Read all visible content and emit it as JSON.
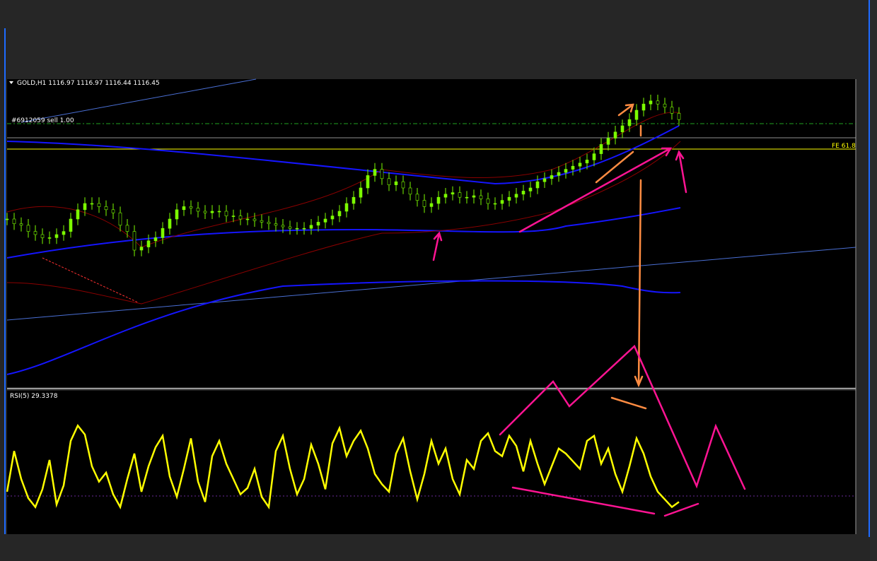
{
  "colors": {
    "background": "#000000",
    "frame": "#262626",
    "bull_candle": "#7CFC00",
    "ma": "#1515ff",
    "bands": "#8b0000",
    "trendline": "#4a6fd4",
    "order_line": "#1fa31f",
    "price_line": "#c0c0c0",
    "fe_line": "#ffff00",
    "rsi": "#ffff00",
    "annotation_pink": "#ff1493",
    "annotation_orange": "#ff8c42"
  },
  "header": {
    "symbol_label": "GOLD,H1  1116.97 1116.97 1116.44 1116.45"
  },
  "order": {
    "label": "#6912059 sell 1.00"
  },
  "fib": {
    "label": "FE 61.8"
  },
  "rsi_panel": {
    "label": "RSI(5) 29.3378"
  },
  "chart_data": {
    "type": "line",
    "symbol": "GOLD",
    "timeframe": "H1",
    "price_panel": {
      "x": [
        0,
        10,
        20,
        30,
        40,
        50,
        60,
        70,
        80,
        90,
        100,
        110,
        120,
        130,
        140,
        150,
        160,
        170,
        180,
        190,
        200,
        210,
        220,
        230,
        240,
        250,
        260,
        270,
        280,
        290,
        300,
        310,
        320,
        330,
        340,
        350,
        360,
        370,
        380,
        390,
        400,
        410,
        420,
        430,
        440,
        450,
        460,
        470,
        480,
        490,
        500,
        510,
        520,
        530,
        540,
        550,
        560,
        570,
        580,
        590,
        600,
        610,
        620,
        630,
        640,
        650,
        660,
        670,
        680,
        690,
        700,
        710,
        720,
        730,
        740,
        750,
        760,
        770,
        780,
        790,
        800,
        810,
        820,
        830,
        840,
        850,
        860,
        870,
        880,
        890,
        900,
        910,
        920,
        930,
        940,
        950
      ],
      "close": [
        50,
        47,
        46,
        42,
        40,
        38,
        38,
        40,
        42,
        50,
        56,
        60,
        60,
        58,
        56,
        54,
        46,
        42,
        30,
        32,
        36,
        38,
        44,
        50,
        56,
        58,
        57,
        55,
        54,
        55,
        55,
        52,
        52,
        50,
        50,
        49,
        48,
        47,
        46,
        45,
        44,
        44,
        44,
        46,
        48,
        50,
        52,
        55,
        60,
        64,
        70,
        78,
        82,
        76,
        72,
        74,
        70,
        66,
        62,
        58,
        60,
        64,
        66,
        67,
        64,
        64,
        65,
        63,
        60,
        60,
        62,
        64,
        66,
        68,
        70,
        74,
        76,
        78,
        80,
        82,
        84,
        86,
        88,
        92,
        98,
        102,
        106,
        110,
        114,
        120,
        124,
        126,
        124,
        122,
        118,
        114
      ]
    },
    "rsi_panel": {
      "ylim": [
        0,
        100
      ],
      "current": 29.3378,
      "values": [
        30,
        62,
        40,
        25,
        18,
        32,
        55,
        20,
        35,
        70,
        82,
        75,
        50,
        38,
        45,
        28,
        18,
        40,
        60,
        30,
        50,
        65,
        74,
        42,
        26,
        48,
        72,
        38,
        22,
        58,
        70,
        52,
        40,
        28,
        33,
        48,
        26,
        18,
        62,
        74,
        48,
        28,
        40,
        67,
        52,
        32,
        68,
        80,
        58,
        70,
        78,
        64,
        44,
        36,
        30,
        60,
        72,
        46,
        24,
        44,
        70,
        52,
        64,
        40,
        28,
        55,
        48,
        70,
        76,
        62,
        58,
        74,
        66,
        46,
        70,
        52,
        36,
        50,
        64,
        60,
        54,
        48,
        70,
        74,
        52,
        64,
        44,
        30,
        50,
        72,
        60,
        42,
        30,
        24,
        18,
        22
      ]
    },
    "levels": [
      "order sell 1.00",
      "FE 61.8"
    ]
  }
}
